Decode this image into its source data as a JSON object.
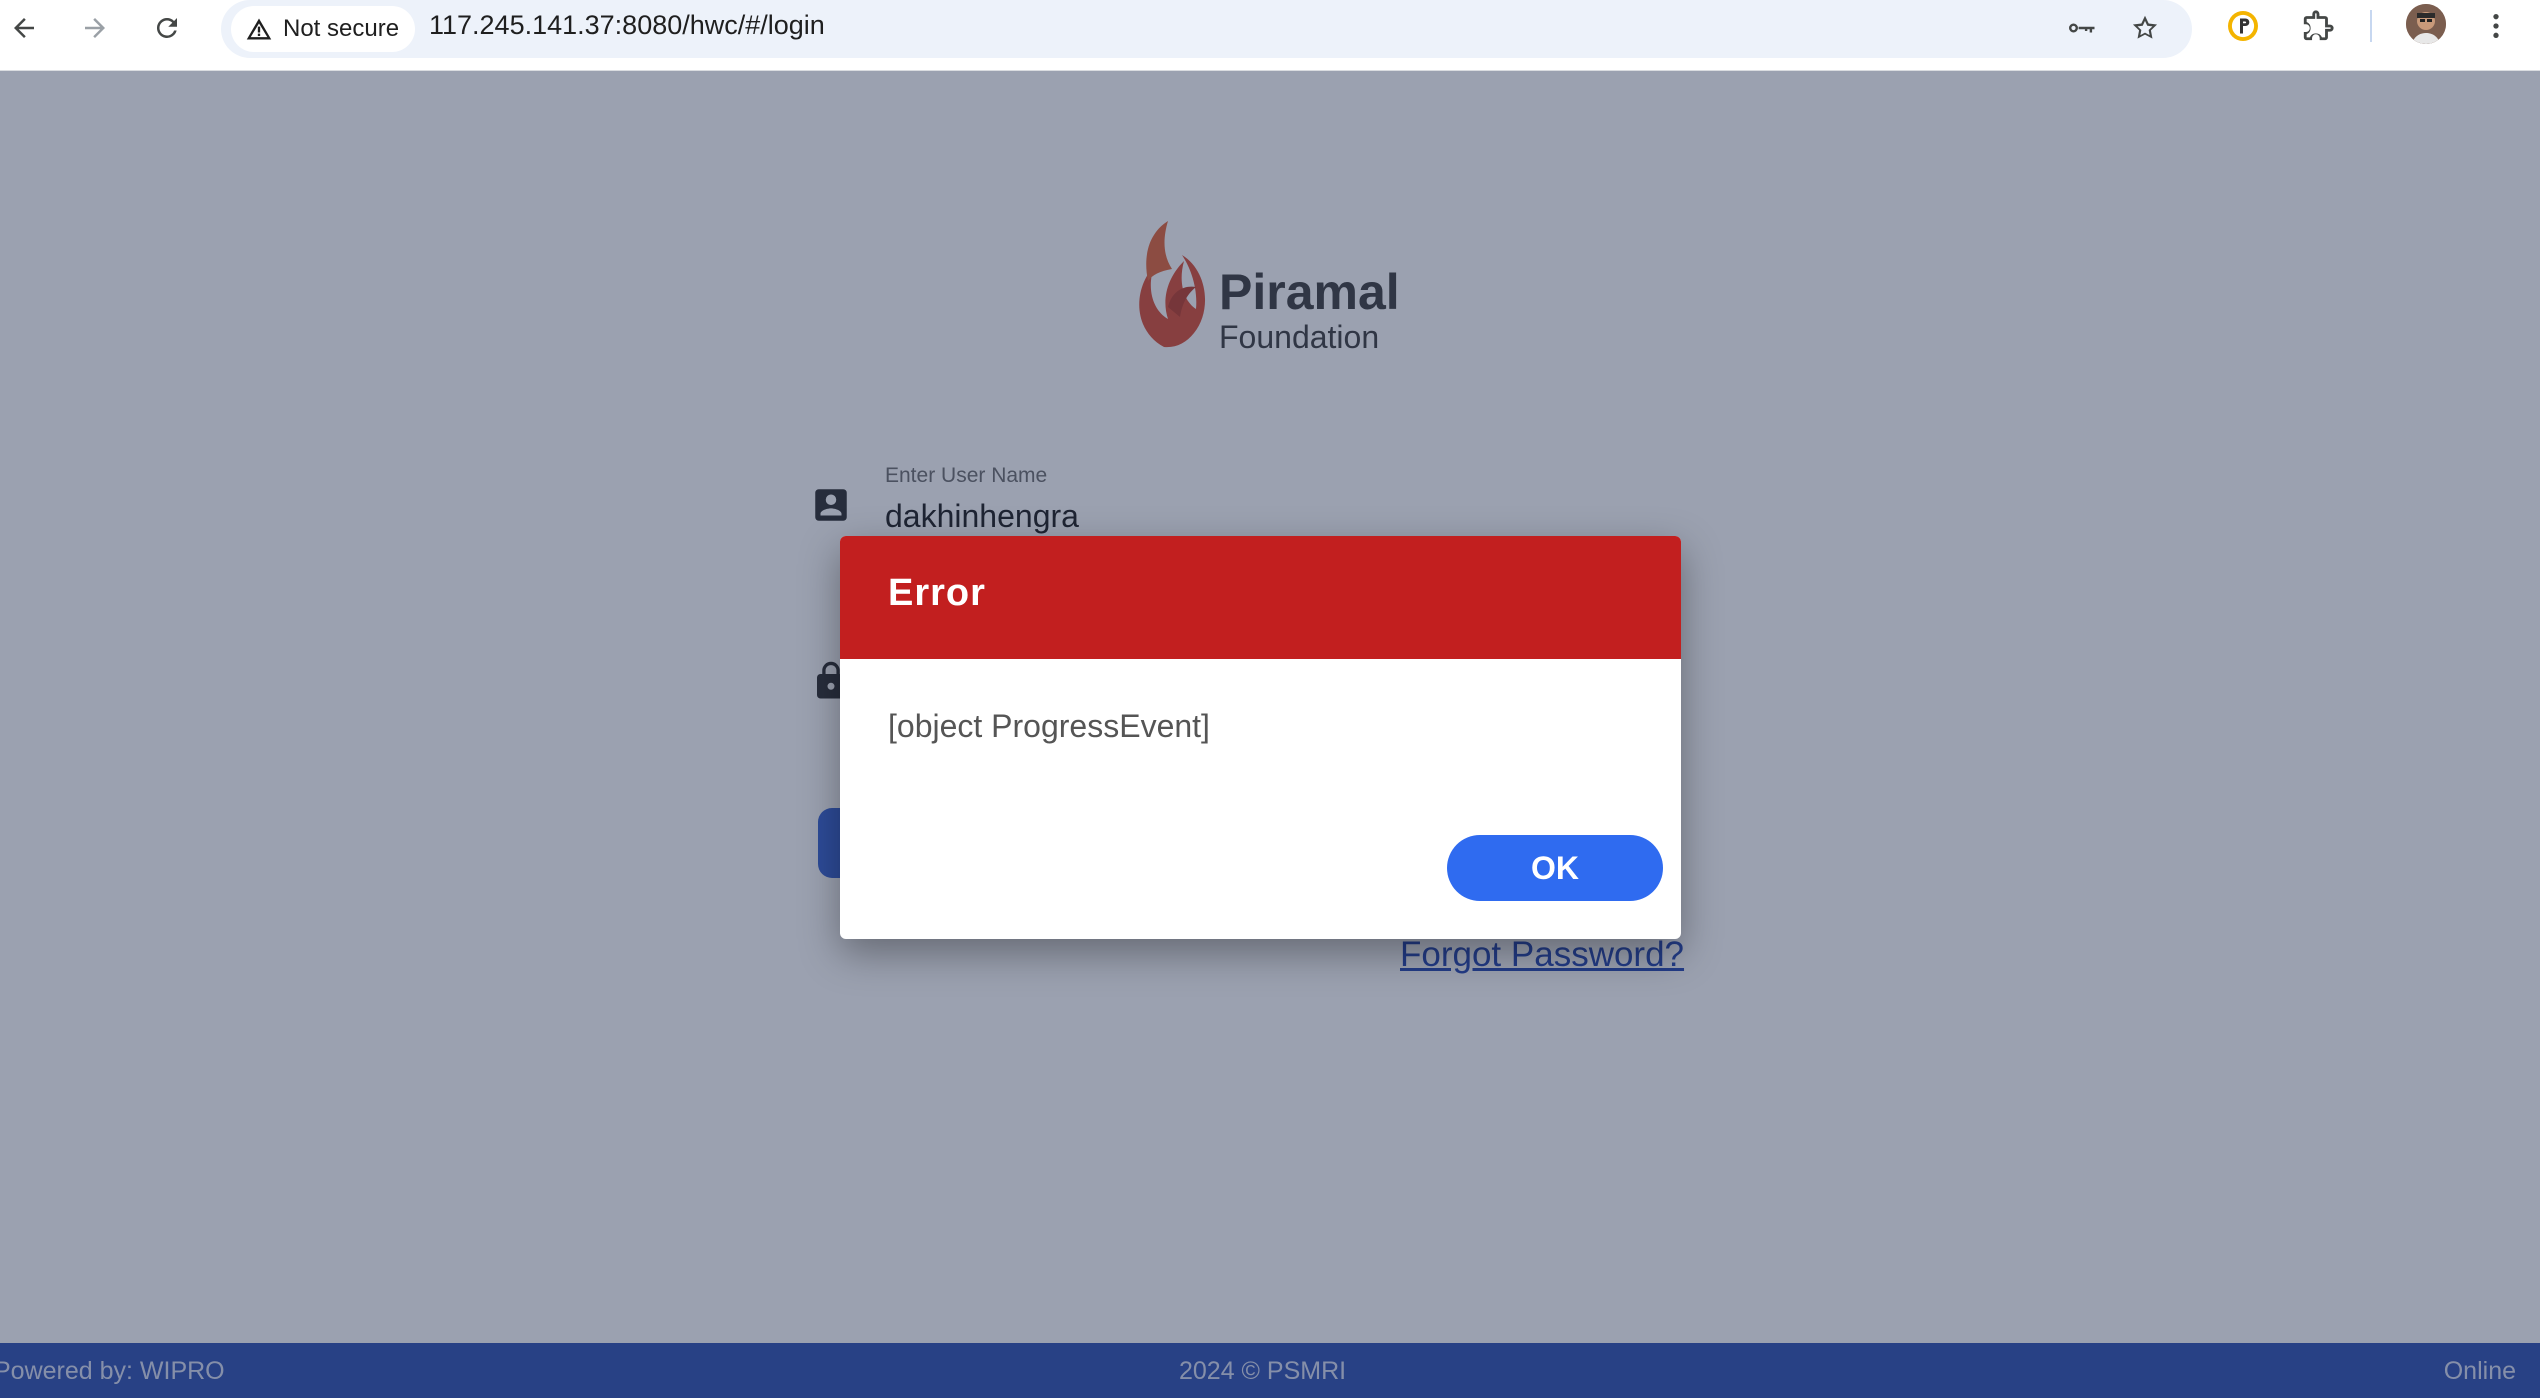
{
  "browser": {
    "security_label": "Not secure",
    "url": "117.245.141.37:8080/hwc/#/login",
    "icons": [
      "back-icon",
      "forward-icon",
      "reload-icon",
      "warning-icon",
      "key-icon",
      "bookmark-star-icon",
      "extension-badge-icon",
      "extensions-puzzle-icon",
      "profile-avatar",
      "menu-kebab-icon"
    ]
  },
  "login": {
    "logo_name": "Piramal",
    "logo_sub": "Foundation",
    "username_label": "Enter User Name",
    "username_value": "dakhinhengra",
    "forgot_password": "Forgot Password?"
  },
  "footer": {
    "powered_by": "Powered by: WIPRO",
    "copyright": "2024 © PSMRI",
    "status": "Online"
  },
  "dialog": {
    "title": "Error",
    "message": "[object ProgressEvent]",
    "ok_label": "OK"
  },
  "colors": {
    "dialog_header": "#c21f1f",
    "ok_button": "#2f6bf0",
    "footer": "#2447ad",
    "link": "#1a3fb0",
    "logo_flame": "#d8442a"
  }
}
